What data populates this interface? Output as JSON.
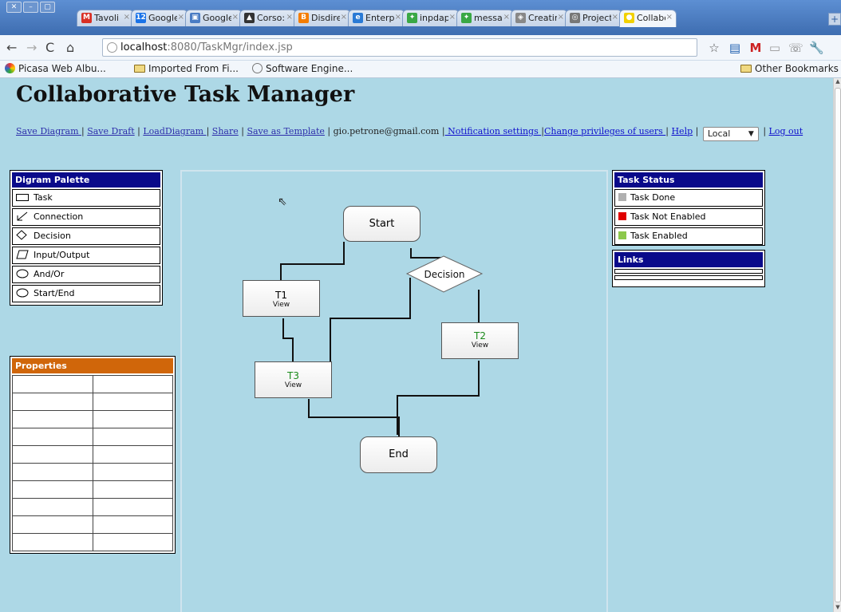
{
  "browser": {
    "window_buttons": [
      "✕",
      "–",
      "▢"
    ],
    "tabs": [
      {
        "label": "Tavoli",
        "icon": "gmail-icon",
        "color": "#d93025",
        "glyph": "M"
      },
      {
        "label": "Google",
        "icon": "calendar-icon",
        "color": "#1a73e8",
        "glyph": "12"
      },
      {
        "label": "Google",
        "icon": "docs-icon",
        "color": "#4a7cc4",
        "glyph": "▣"
      },
      {
        "label": "Corso:",
        "icon": "cap-icon",
        "color": "#333333",
        "glyph": "▲"
      },
      {
        "label": "Disdire",
        "icon": "blogger-icon",
        "color": "#f57d00",
        "glyph": "B"
      },
      {
        "label": "Enterp",
        "icon": "ie-icon",
        "color": "#2a7ad5",
        "glyph": "e"
      },
      {
        "label": "inpdap",
        "icon": "puzzle-icon",
        "color": "#3aa845",
        "glyph": "✦"
      },
      {
        "label": "messag",
        "icon": "puzzle-icon",
        "color": "#3aa845",
        "glyph": "✦"
      },
      {
        "label": "Creatir",
        "icon": "cube-icon",
        "color": "#888888",
        "glyph": "◈"
      },
      {
        "label": "Project",
        "icon": "globe-icon",
        "color": "#777777",
        "glyph": "◎"
      },
      {
        "label": "Collabo",
        "icon": "sun-icon",
        "color": "#f2d100",
        "glyph": "●"
      }
    ],
    "new_tab": "+",
    "url_host": "localhost",
    "url_path": ":8080/TaskMgr/index.jsp",
    "bookmarks": [
      {
        "label": "Picasa Web Albu...",
        "icon": "picasa-icon"
      },
      {
        "label": "Imported From Fi...",
        "icon": "folder-icon"
      },
      {
        "label": "Software Engine...",
        "icon": "globe-icon"
      }
    ],
    "other_bookmarks": "Other Bookmarks"
  },
  "app": {
    "title": "Collaborative Task Manager",
    "menu": {
      "save_diagram": "Save Diagram ",
      "save_draft": "Save Draft",
      "load_diagram": "LoadDiagram ",
      "share": "Share",
      "save_template": "Save as Template",
      "user": " gio.petrone@gmail.com ",
      "notification": " Notification settings ",
      "privileges": "Change privileges of users ",
      "help": "Help",
      "lang_value": "Local",
      "logout": "Log out",
      "sep": " | "
    },
    "palette": {
      "title": "Digram Palette",
      "items": [
        "Task",
        "Connection",
        "Decision",
        "Input/Output",
        "And/Or",
        "Start/End"
      ]
    },
    "properties": {
      "title": "Properties",
      "row_count": 10
    },
    "task_status": {
      "title": "Task Status",
      "items": [
        {
          "label": "Task Done",
          "color": "#b0b0b0"
        },
        {
          "label": "Task Not Enabled",
          "color": "#e00000"
        },
        {
          "label": "Task Enabled",
          "color": "#8cc84b"
        }
      ]
    },
    "links": {
      "title": "Links"
    },
    "diagram": {
      "start": "Start",
      "decision": "Decision",
      "end": "End",
      "tasks": [
        {
          "id": "T1",
          "sub": "View",
          "status": "default"
        },
        {
          "id": "T2",
          "sub": "View",
          "status": "enabled"
        },
        {
          "id": "T3",
          "sub": "View",
          "status": "enabled"
        }
      ]
    }
  }
}
